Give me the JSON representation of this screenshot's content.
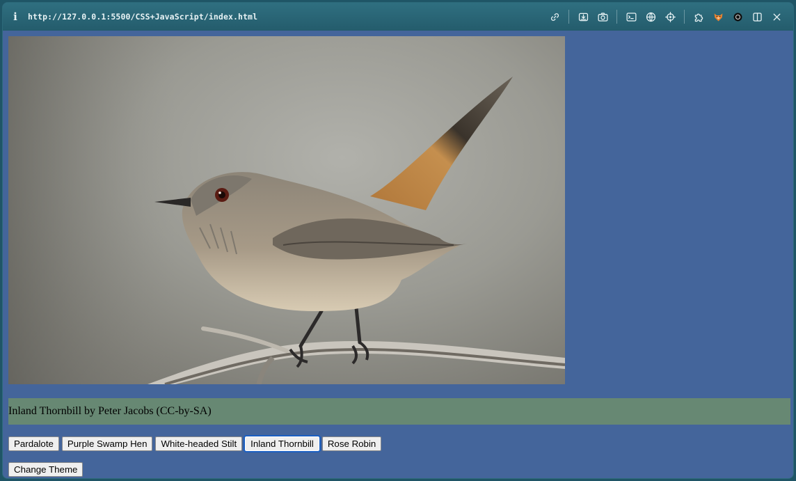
{
  "browser": {
    "info_icon_label": "i",
    "url": "http://127.0.0.1:5500/CSS+JavaScript/index.html",
    "toolbar_icons": [
      "link-icon",
      "download-icon",
      "camera-icon",
      "terminal-icon",
      "globe-icon",
      "crosshair-icon",
      "extension-icon",
      "fox-icon",
      "openai-icon",
      "sidebar-icon",
      "close-icon"
    ]
  },
  "gallery": {
    "image_subject": "Inland Thornbill",
    "caption": "Inland Thornbill by Peter Jacobs (CC-by-SA)",
    "buttons": [
      {
        "label": "Pardalote"
      },
      {
        "label": "Purple Swamp Hen"
      },
      {
        "label": "White-headed Stilt"
      },
      {
        "label": "Inland Thornbill",
        "active": true
      },
      {
        "label": "Rose Robin"
      }
    ],
    "theme_button": "Change Theme"
  },
  "colors": {
    "page_background": "#44659b",
    "caption_background": "#678873",
    "toolbar": "#2a6676",
    "focus_ring": "#1a5fc2"
  }
}
